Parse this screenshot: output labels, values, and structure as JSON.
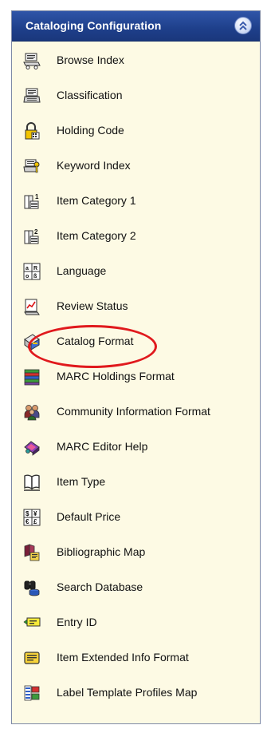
{
  "panel": {
    "title": "Cataloging Configuration",
    "collapse_icon": "chevron-up-double-icon"
  },
  "items": [
    {
      "label": "Browse Index",
      "icon": "browse-index-icon"
    },
    {
      "label": "Classification",
      "icon": "classification-icon"
    },
    {
      "label": "Holding Code",
      "icon": "holding-code-icon"
    },
    {
      "label": "Keyword Index",
      "icon": "keyword-index-icon"
    },
    {
      "label": "Item Category 1",
      "icon": "item-category-1-icon"
    },
    {
      "label": "Item Category 2",
      "icon": "item-category-2-icon"
    },
    {
      "label": "Language",
      "icon": "language-icon"
    },
    {
      "label": "Review Status",
      "icon": "review-status-icon"
    },
    {
      "label": "Catalog Format",
      "icon": "catalog-format-icon"
    },
    {
      "label": "MARC Holdings Format",
      "icon": "marc-holdings-format-icon"
    },
    {
      "label": "Community Information Format",
      "icon": "community-information-format-icon"
    },
    {
      "label": "MARC Editor Help",
      "icon": "marc-editor-help-icon"
    },
    {
      "label": "Item Type",
      "icon": "item-type-icon"
    },
    {
      "label": "Default Price",
      "icon": "default-price-icon"
    },
    {
      "label": "Bibliographic Map",
      "icon": "bibliographic-map-icon"
    },
    {
      "label": "Search Database",
      "icon": "search-database-icon"
    },
    {
      "label": "Entry ID",
      "icon": "entry-id-icon"
    },
    {
      "label": "Item Extended Info Format",
      "icon": "item-extended-info-format-icon"
    },
    {
      "label": "Label Template Profiles Map",
      "icon": "label-template-profiles-map-icon"
    }
  ],
  "highlighted_item": "Catalog Format",
  "colors": {
    "header_bg": "#1e3f8a",
    "panel_bg": "#fdfae4",
    "highlight_ring": "#e0191d"
  }
}
